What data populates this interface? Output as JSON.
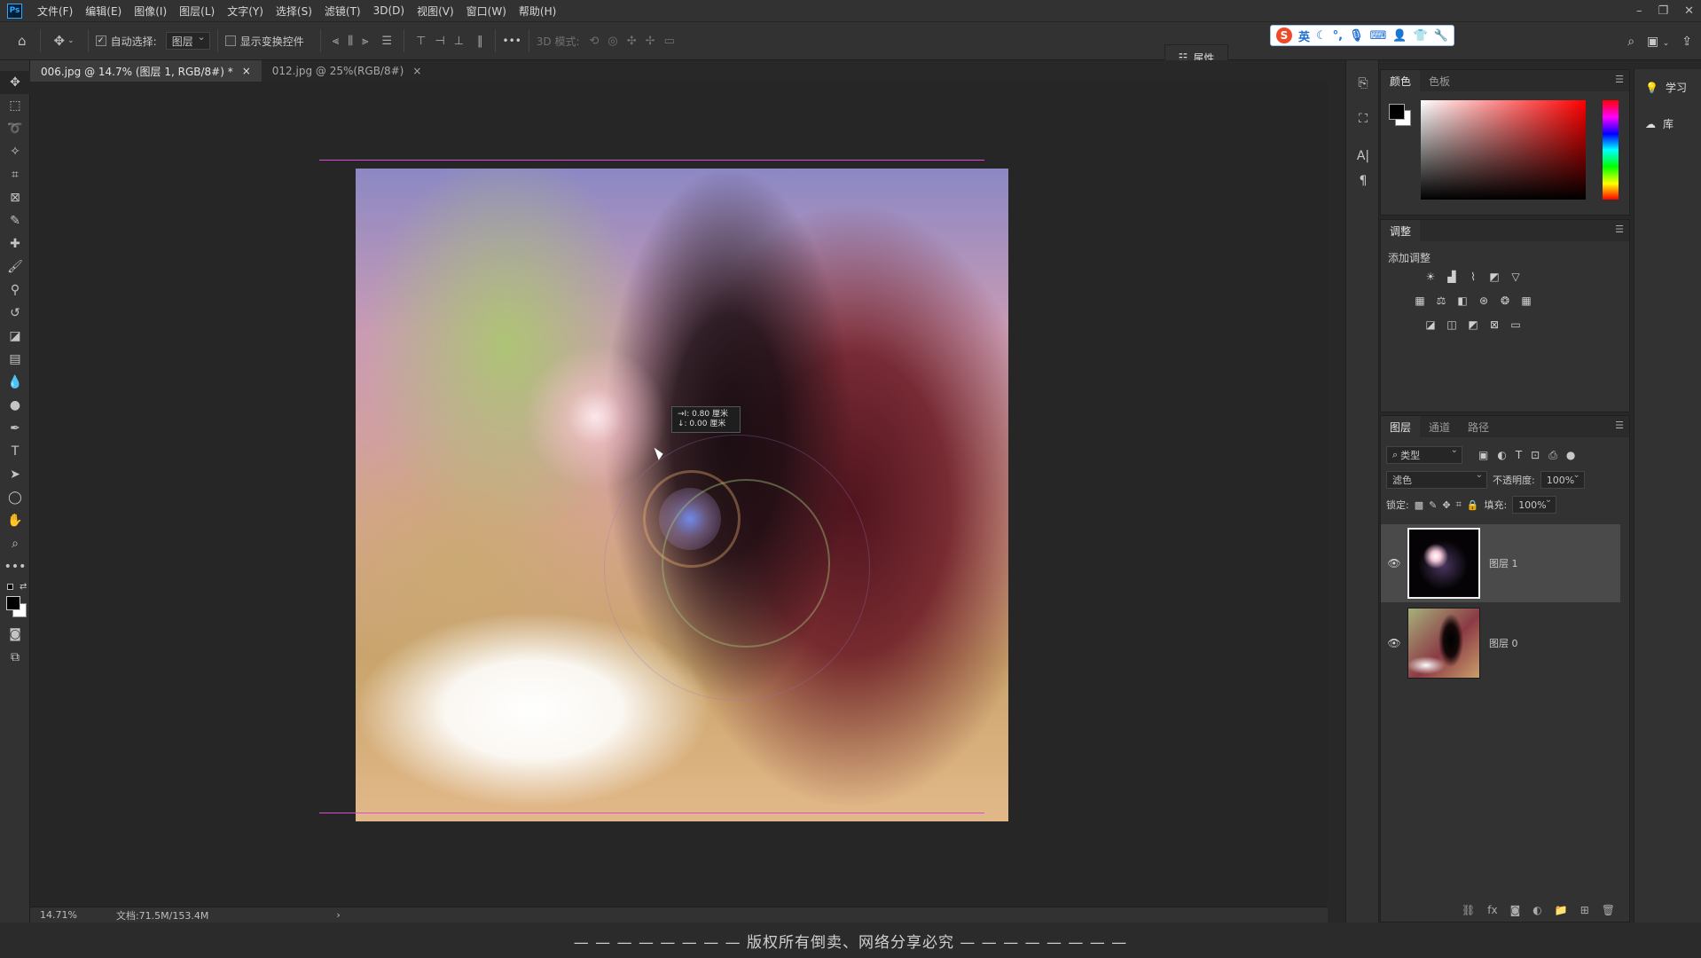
{
  "app": {
    "logo": "Ps"
  },
  "menu": [
    "文件(F)",
    "编辑(E)",
    "图像(I)",
    "图层(L)",
    "文字(Y)",
    "选择(S)",
    "滤镜(T)",
    "3D(D)",
    "视图(V)",
    "窗口(W)",
    "帮助(H)"
  ],
  "options": {
    "auto_select_label": "自动选择:",
    "auto_select_value": "图层",
    "show_transform_label": "显示变换控件",
    "mode_3d_label": "3D 模式:",
    "more_label": "•••"
  },
  "ime": {
    "lang": "英"
  },
  "tabs": [
    {
      "label": "006.jpg @ 14.7% (图层 1, RGB/8#) *",
      "close": "×"
    },
    {
      "label": "012.jpg @ 25%(RGB/8#)",
      "close": "×"
    }
  ],
  "canvas": {
    "measure_line1": "→I: 0.80 厘米",
    "measure_line2": "↓: 0.00 厘米"
  },
  "status": {
    "zoom": "14.71%",
    "doc": "文档:71.5M/153.4M",
    "arrow": "›"
  },
  "copyright": "— — — — — — — — 版权所有倒卖、网络分享必究 — — — — — — — —",
  "properties_button": "属性",
  "color_panel": {
    "tabs": [
      "颜色",
      "色板"
    ]
  },
  "adjustments_panel": {
    "tab": "调整",
    "add_label": "添加调整"
  },
  "layers_panel": {
    "tabs": [
      "图层",
      "通道",
      "路径"
    ],
    "filter_kind": "类型",
    "blend_mode": "滤色",
    "opacity_label": "不透明度:",
    "opacity_value": "100%",
    "lock_label": "锁定:",
    "fill_label": "填充:",
    "fill_value": "100%",
    "layers": [
      {
        "name": "图层 1",
        "visible": true,
        "selected": true
      },
      {
        "name": "图层 0",
        "visible": true,
        "selected": false
      }
    ]
  },
  "learn_panel": {
    "items": [
      "学习",
      "库"
    ]
  },
  "colors": {
    "guide": "#d84bd8",
    "foreground": "#000000",
    "background": "#ffffff"
  }
}
